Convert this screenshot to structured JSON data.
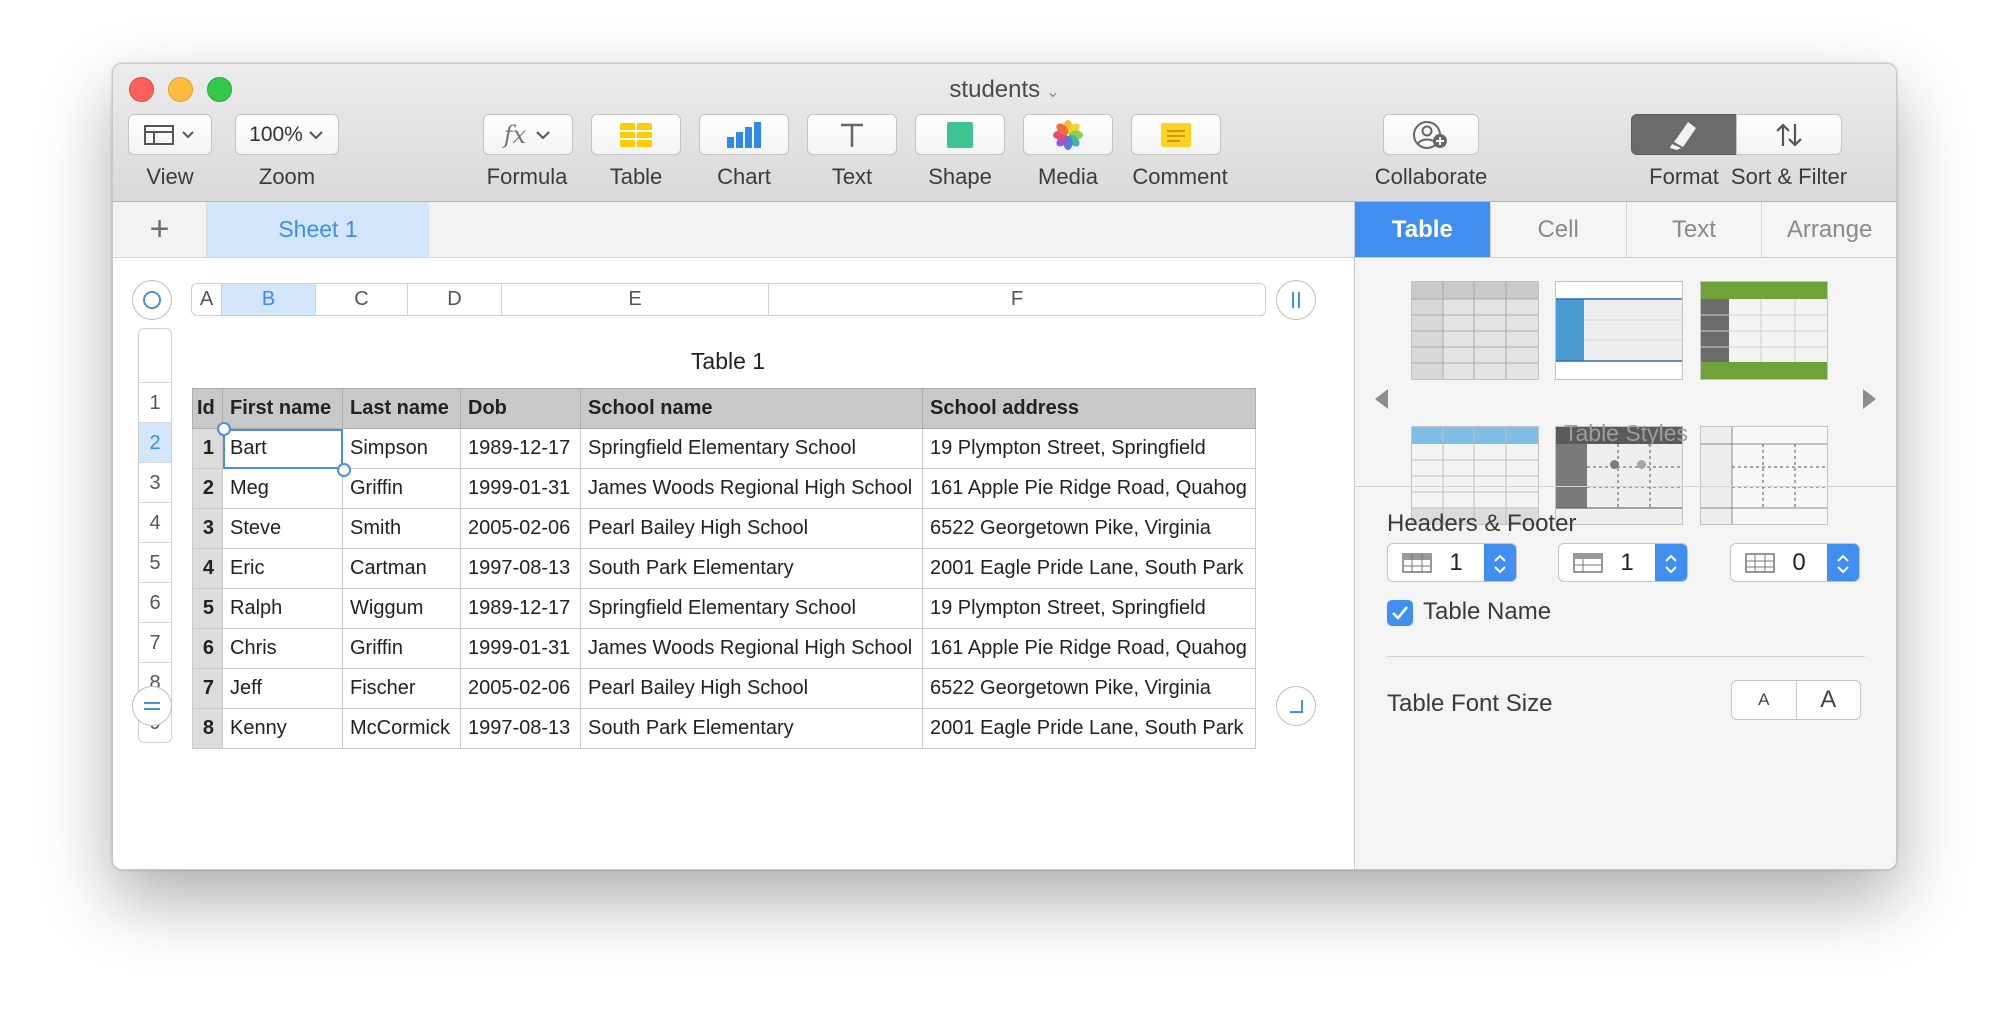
{
  "window": {
    "title": "students"
  },
  "toolbar": {
    "view_label": "View",
    "zoom_value": "100%",
    "zoom_label": "Zoom",
    "formula_label": "Formula",
    "table_label": "Table",
    "chart_label": "Chart",
    "text_label": "Text",
    "shape_label": "Shape",
    "media_label": "Media",
    "comment_label": "Comment",
    "collaborate_label": "Collaborate",
    "format_label": "Format",
    "sort_filter_label": "Sort & Filter"
  },
  "sheets": {
    "add_icon": "plus-icon",
    "active_tab": "Sheet 1"
  },
  "grid": {
    "column_letters": [
      "A",
      "B",
      "C",
      "D",
      "E",
      "F"
    ],
    "selected_column": "B",
    "row_numbers": [
      "1",
      "2",
      "3",
      "4",
      "5",
      "6",
      "7",
      "8",
      "9"
    ],
    "selected_row": "2"
  },
  "table": {
    "title": "Table 1",
    "headers": [
      "Id",
      "First name",
      "Last name",
      "Dob",
      "School name",
      "School address"
    ],
    "rows": [
      [
        "1",
        "Bart",
        "Simpson",
        "1989-12-17",
        "Springfield Elementary School",
        "19 Plympton Street, Springfield"
      ],
      [
        "2",
        "Meg",
        "Griffin",
        "1999-01-31",
        "James Woods Regional High School",
        "161 Apple Pie Ridge Road, Quahog"
      ],
      [
        "3",
        "Steve",
        "Smith",
        "2005-02-06",
        "Pearl Bailey High School",
        "6522 Georgetown Pike, Virginia"
      ],
      [
        "4",
        "Eric",
        "Cartman",
        "1997-08-13",
        "South Park Elementary",
        "2001 Eagle Pride Lane, South Park"
      ],
      [
        "5",
        "Ralph",
        "Wiggum",
        "1989-12-17",
        "Springfield Elementary School",
        "19 Plympton Street, Springfield"
      ],
      [
        "6",
        "Chris",
        "Griffin",
        "1999-01-31",
        "James Woods Regional High School",
        "161 Apple Pie Ridge Road, Quahog"
      ],
      [
        "7",
        "Jeff",
        "Fischer",
        "2005-02-06",
        "Pearl Bailey High School",
        "6522 Georgetown Pike, Virginia"
      ],
      [
        "8",
        "Kenny",
        "McCormick",
        "1997-08-13",
        "South Park Elementary",
        "2001 Eagle Pride Lane, South Park"
      ]
    ]
  },
  "inspector": {
    "tabs": [
      "Table",
      "Cell",
      "Text",
      "Arrange"
    ],
    "active_tab": "Table",
    "table_styles_label": "Table Styles",
    "headers_footer_title": "Headers & Footer",
    "header_rows": "1",
    "header_columns": "1",
    "footer_rows": "0",
    "table_name_label": "Table Name",
    "table_name_checked": true,
    "table_font_size_label": "Table Font Size",
    "font_smaller": "A",
    "font_larger": "A"
  },
  "colors": {
    "accent": "#3f8ef0",
    "selection": "#d3e5fa",
    "header_row": "#c8c8c8",
    "style_green": "#6fa33a",
    "style_blue": "#4a9bd1",
    "style_sky": "#7dbde6",
    "style_dark": "#5a5a5a"
  }
}
